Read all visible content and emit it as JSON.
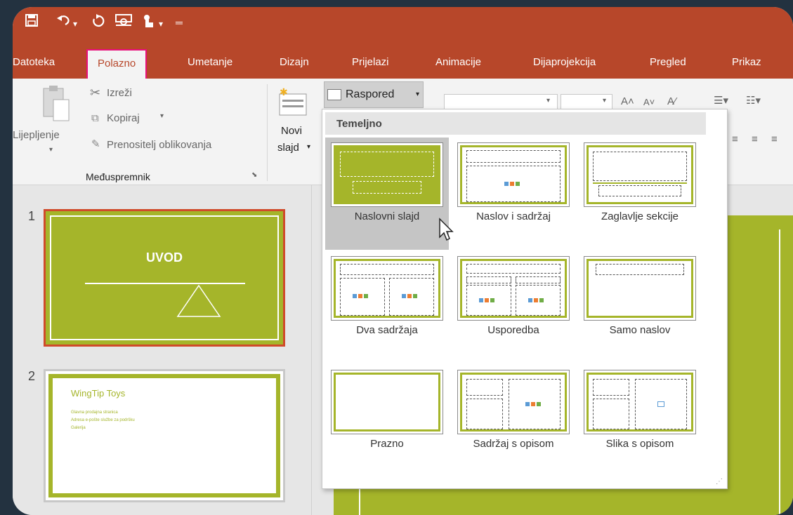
{
  "quick_access": [
    "save-icon",
    "undo-icon",
    "redo-icon",
    "presenter-icon",
    "touch-mode-icon",
    "customize-icon"
  ],
  "tabs": [
    {
      "label": "Datoteka"
    },
    {
      "label": "Polazno"
    },
    {
      "label": "Umetanje"
    },
    {
      "label": "Dizajn"
    },
    {
      "label": "Prijelazi"
    },
    {
      "label": "Animacije"
    },
    {
      "label": "Dijaprojekcija"
    },
    {
      "label": "Pregled"
    },
    {
      "label": "Prikaz"
    }
  ],
  "ribbon": {
    "paste": "Lijepljenje",
    "cut": "Izreži",
    "copy": "Kopiraj",
    "format_painter": "Prenositelj oblikovanja",
    "clipboard_group": "Međuspremnik",
    "new_slide_1": "Novi",
    "new_slide_2": "slajd",
    "layout_button": "Raspored"
  },
  "dropdown": {
    "section": "Temeljno",
    "layouts": [
      {
        "label": "Naslovni slajd"
      },
      {
        "label": "Naslov i sadržaj"
      },
      {
        "label": "Zaglavlje sekcije"
      },
      {
        "label": "Dva sadržaja"
      },
      {
        "label": "Usporedba"
      },
      {
        "label": "Samo naslov"
      },
      {
        "label": "Prazno"
      },
      {
        "label": "Sadržaj s opisom"
      },
      {
        "label": "Slika s opisom"
      }
    ]
  },
  "slides": [
    {
      "num": "1",
      "title": "UVOD"
    },
    {
      "num": "2",
      "title": "WingTip Toys",
      "bullets": [
        "Glavna prodajna stranica",
        "Adresa e-pošte službe za podršku",
        "Galerija"
      ]
    }
  ],
  "colors": {
    "accent": "#b7472a",
    "slide_green": "#a5b52a",
    "highlight": "#e8107a"
  }
}
